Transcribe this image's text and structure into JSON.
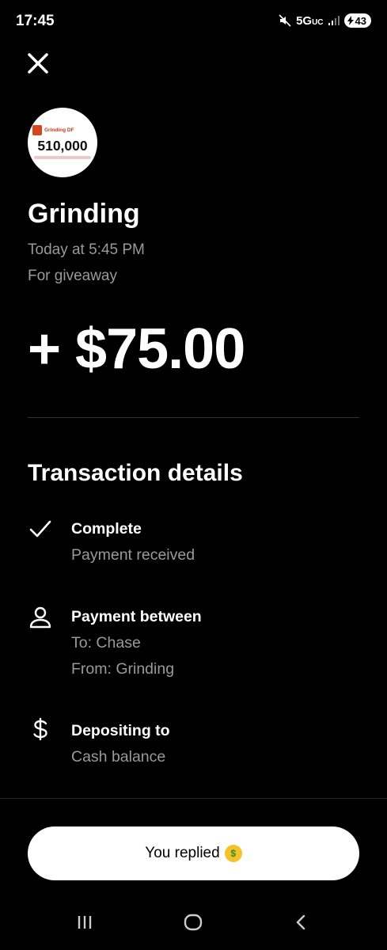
{
  "status_bar": {
    "time": "17:45",
    "network": "5G",
    "network_suffix": "UC",
    "battery": "43",
    "icons": [
      "mute-icon",
      "signal-icon",
      "charging-icon"
    ]
  },
  "header": {
    "close_icon": "close-icon"
  },
  "avatar": {
    "name": "Grinding DF",
    "count": "510,000"
  },
  "transaction": {
    "name": "Grinding",
    "date": "Today at 5:45 PM",
    "note": "For giveaway",
    "amount": "+ $75.00"
  },
  "details": {
    "title": "Transaction details",
    "rows": [
      {
        "icon": "checkmark-icon",
        "heading": "Complete",
        "lines": [
          "Payment received"
        ]
      },
      {
        "icon": "person-icon",
        "heading": "Payment between",
        "lines": [
          "To: Chase",
          "From: Grinding"
        ]
      },
      {
        "icon": "dollar-icon",
        "heading": "Depositing to",
        "lines": [
          "Cash balance"
        ]
      }
    ]
  },
  "reply_button": {
    "label": "You replied",
    "emoji": "money-mouth-face"
  },
  "nav_bar": {
    "icons": [
      "recents-icon",
      "home-icon",
      "back-icon"
    ]
  },
  "colors": {
    "background": "#000000",
    "text": "#ffffff",
    "muted": "#9a9a9a",
    "button": "#ffffff"
  }
}
